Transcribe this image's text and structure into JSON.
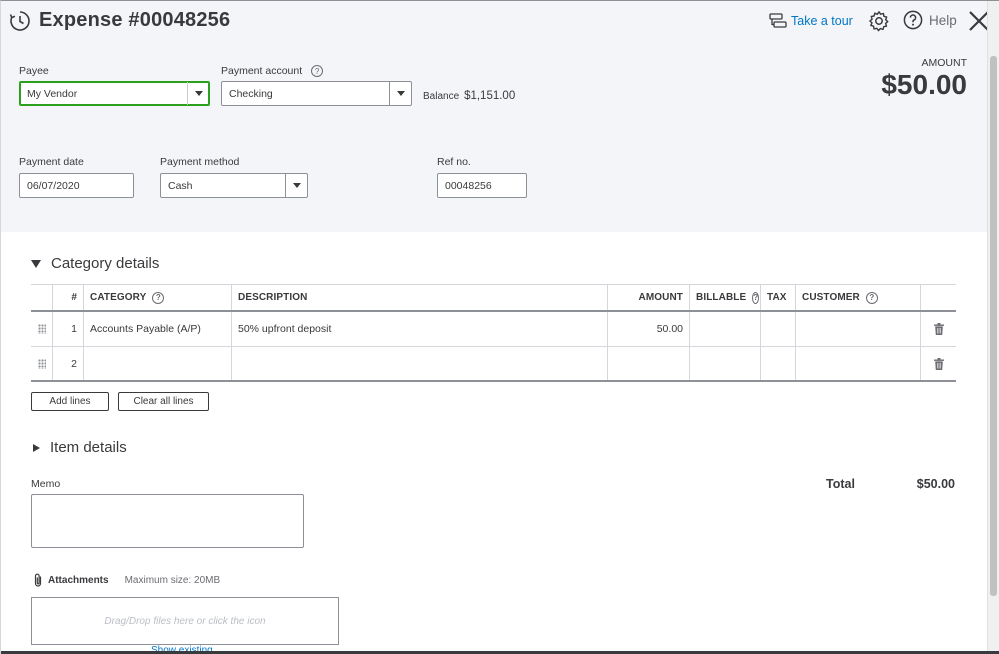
{
  "header": {
    "title": "Expense #00048256",
    "take_tour": "Take a tour",
    "help": "Help"
  },
  "payee": {
    "label": "Payee",
    "value": "My Vendor"
  },
  "payment_account": {
    "label": "Payment account",
    "value": "Checking",
    "balance_label": "Balance",
    "balance_value": "$1,151.00"
  },
  "amount": {
    "label": "AMOUNT",
    "value": "$50.00"
  },
  "payment_date": {
    "label": "Payment date",
    "value": "06/07/2020"
  },
  "payment_method": {
    "label": "Payment method",
    "value": "Cash"
  },
  "ref_no": {
    "label": "Ref no.",
    "value": "00048256"
  },
  "category_details": {
    "title": "Category details",
    "columns": [
      "#",
      "CATEGORY",
      "DESCRIPTION",
      "AMOUNT",
      "BILLABLE",
      "TAX",
      "CUSTOMER"
    ],
    "rows": [
      {
        "num": "1",
        "category": "Accounts Payable (A/P)",
        "description": "50% upfront deposit",
        "amount": "50.00"
      },
      {
        "num": "2",
        "category": "",
        "description": "",
        "amount": ""
      }
    ],
    "add_lines": "Add lines",
    "clear_all_lines": "Clear all lines"
  },
  "item_details": {
    "title": "Item details"
  },
  "memo": {
    "label": "Memo"
  },
  "total": {
    "label": "Total",
    "value": "$50.00"
  },
  "attachments": {
    "label": "Attachments",
    "max_size": "Maximum size: 20MB",
    "drop_text": "Drag/Drop files here or click the icon",
    "show_existing": "Show existing"
  },
  "colors": {
    "accent_link": "#0077c5",
    "focus_green": "#2ca01c",
    "text": "#393a3d"
  },
  "icons": [
    "history-icon",
    "take-tour-icon",
    "gear-icon",
    "help-icon",
    "close-icon",
    "question-icon",
    "drag-handle-icon",
    "trash-icon",
    "paperclip-icon"
  ]
}
